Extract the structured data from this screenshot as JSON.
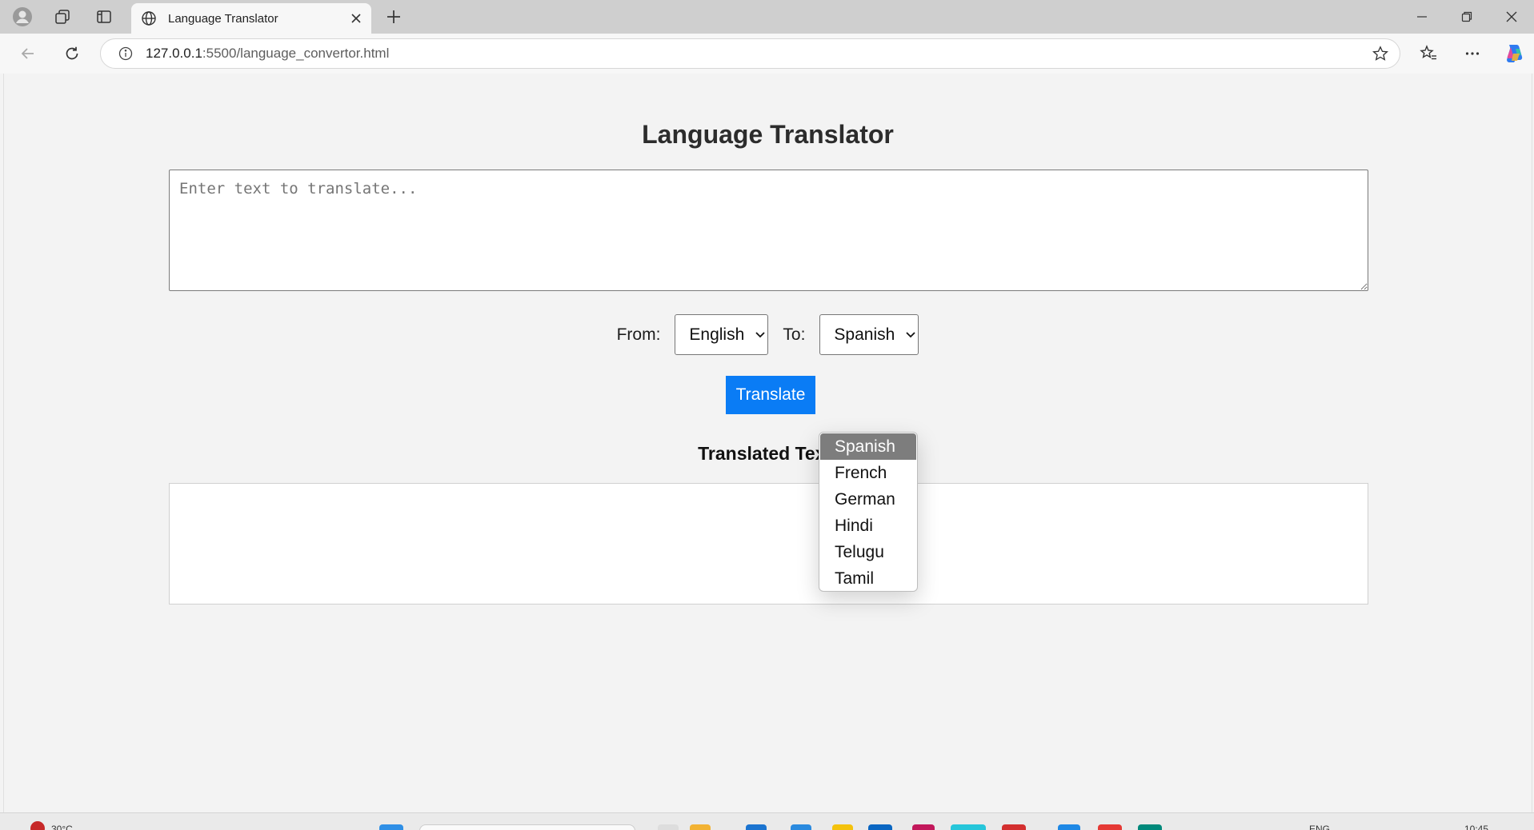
{
  "browser": {
    "tab": {
      "title": "Language Translator"
    },
    "address_bar": {
      "host": "127.0.0.1",
      "path": ":5500/language_convertor.html"
    }
  },
  "page": {
    "title": "Language Translator",
    "source_text": {
      "placeholder": "Enter text to translate...",
      "value": ""
    },
    "from": {
      "label": "From:",
      "selected": "English"
    },
    "to": {
      "label": "To:",
      "selected": "Spanish"
    },
    "translate_button": "Translate",
    "result_heading": "Translated Text:",
    "result_text": "",
    "to_options": [
      "Spanish",
      "French",
      "German",
      "Hindi",
      "Telugu",
      "Tamil"
    ],
    "highlighted_option": "Spanish"
  },
  "taskbar": {
    "weather": "30°C",
    "language": "ENG",
    "time": "10:45"
  },
  "colors": {
    "accent": "#0a7cf5",
    "page_bg": "#f3f3f3",
    "option_highlight": "#7d7d7d"
  }
}
